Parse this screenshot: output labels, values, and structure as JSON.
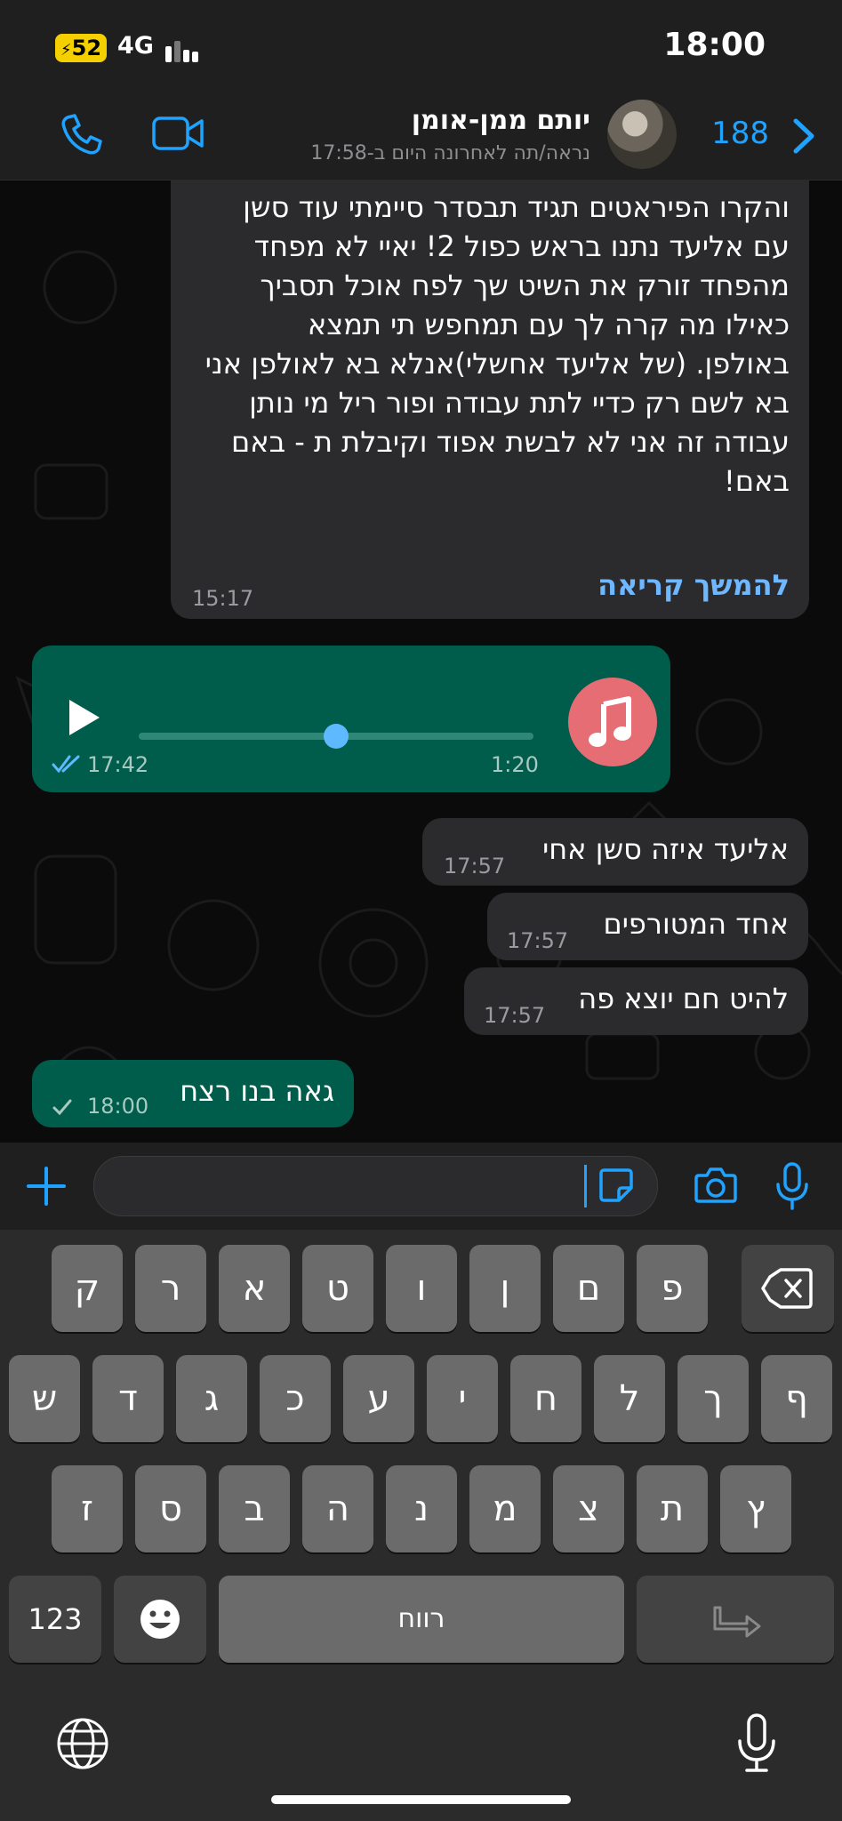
{
  "status_bar": {
    "time": "18:00",
    "battery": "52",
    "network": "4G"
  },
  "header": {
    "contact_name": "יותם ממן-אומן",
    "last_seen": "נראה/תה לאחרונה היום ב-17:58",
    "unread_count": "188"
  },
  "messages": {
    "long": {
      "text": "והקרו הפיראטים תגיד תבסדר סיימתי עוד סשן\nעם אליעד נתנו בראש כפול 2! יאיי לא מפחד\nמהפחד זורק את השיט שך לפח אוכל תסביך\nכאילו מה קרה לך עם תמחפש תי תמצא\nבאולפן. (של אליעד אחשלי)אנלא בא לאולפן אני\nבא לשם רק כדיי לתת עבודה ופור ריל מי נותן\nעבודה זה אני לא לבשת אפוד וקיבלת ת - באם\nבאם!",
      "read_more": "להמשך קריאה",
      "time": "15:17"
    },
    "voice": {
      "duration": "1:20",
      "time": "17:42",
      "progress": 0.49
    },
    "quick": [
      {
        "text": "אליעד איזה סשן אחי",
        "time": "17:57"
      },
      {
        "text": "אחד המטורפים",
        "time": "17:57"
      },
      {
        "text": "להיט חם יוצא פה",
        "time": "17:57"
      }
    ],
    "sent": {
      "text": "גאה בנו רצח",
      "time": "18:00"
    }
  },
  "keyboard": {
    "row1": [
      "ק",
      "ר",
      "א",
      "ט",
      "ו",
      "ן",
      "ם",
      "פ"
    ],
    "row2": [
      "ש",
      "ד",
      "ג",
      "כ",
      "ע",
      "י",
      "ח",
      "ל",
      "ך",
      "ף"
    ],
    "row3": [
      "ז",
      "ס",
      "ב",
      "ה",
      "נ",
      "מ",
      "צ",
      "ת",
      "ץ"
    ],
    "numbers_label": "123",
    "space_label": "רווח"
  },
  "colors": {
    "accent": "#1fa3ff",
    "outgoing": "#005c4b",
    "incoming": "#2b2b2e",
    "read_more": "#6fb8ff"
  }
}
